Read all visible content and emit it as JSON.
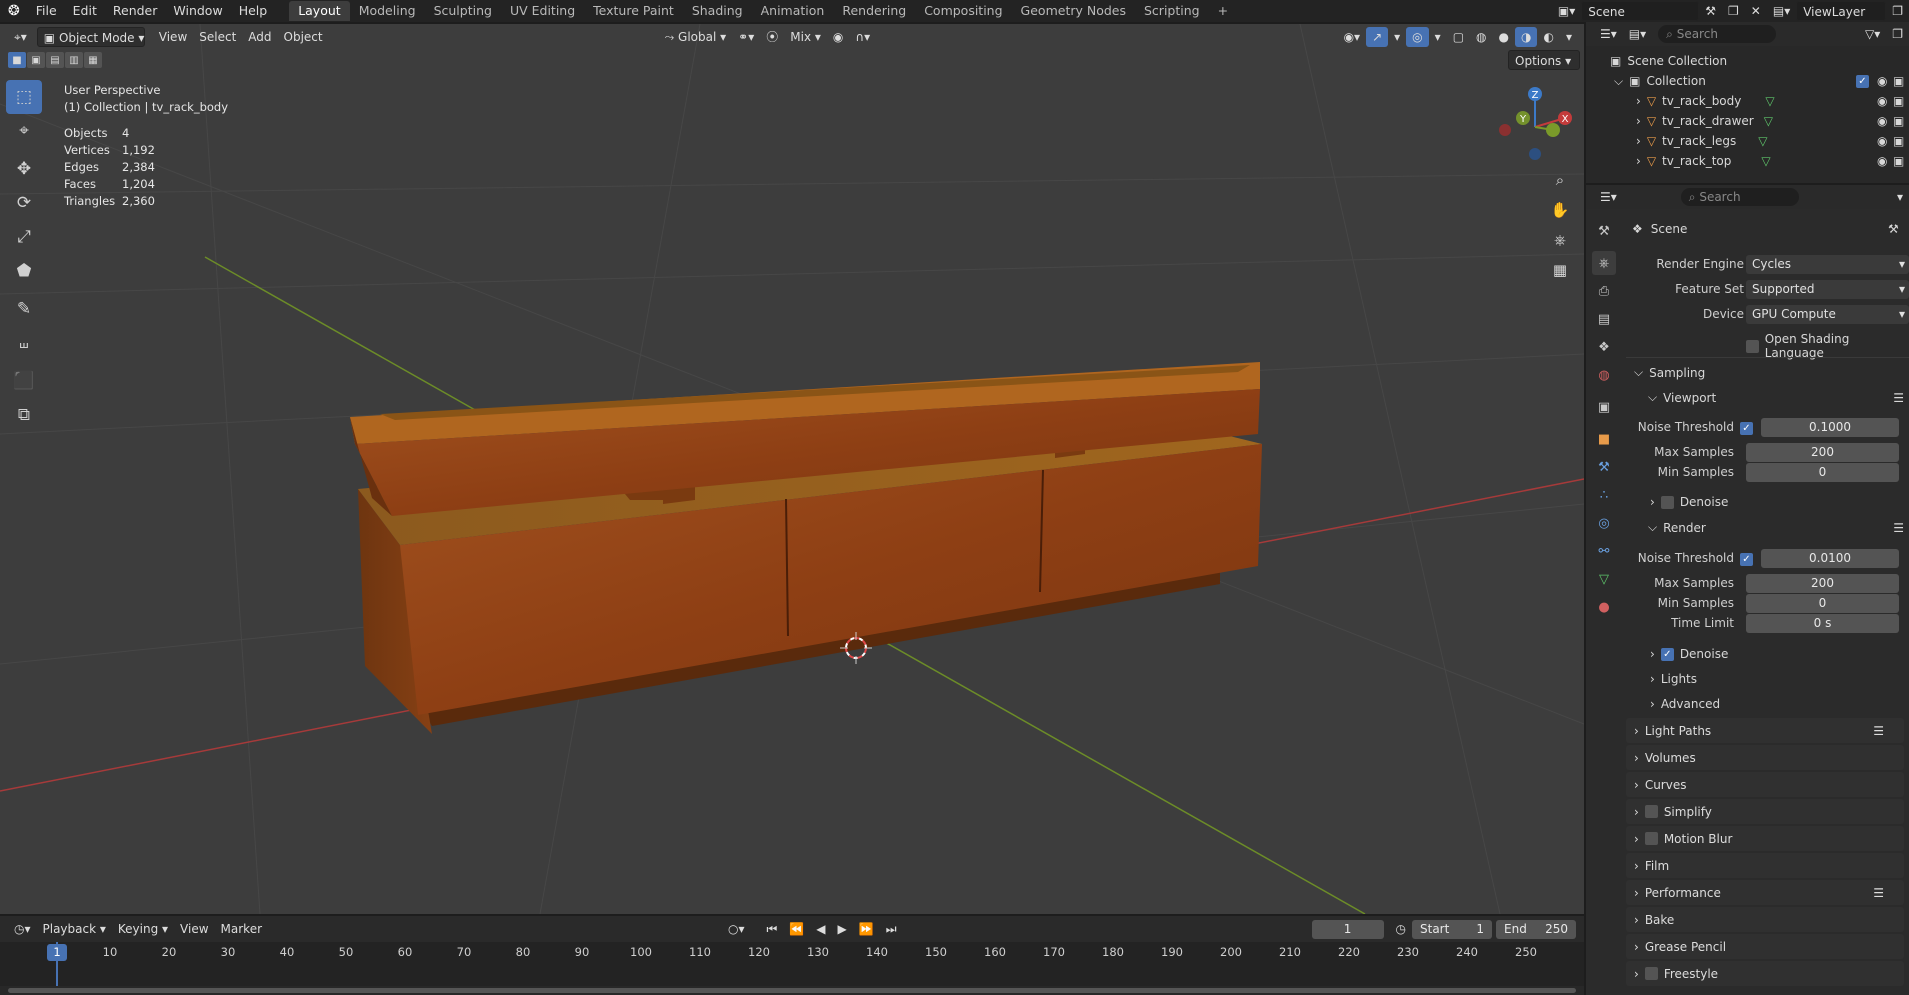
{
  "topbar": {
    "menus": [
      "File",
      "Edit",
      "Render",
      "Window",
      "Help"
    ],
    "workspaces": [
      "Layout",
      "Modeling",
      "Sculpting",
      "UV Editing",
      "Texture Paint",
      "Shading",
      "Animation",
      "Rendering",
      "Compositing",
      "Geometry Nodes",
      "Scripting"
    ],
    "active_workspace": "Layout",
    "scene_name": "Scene",
    "view_layer": "ViewLayer"
  },
  "viewport_header": {
    "mode": "Object Mode",
    "menus": [
      "View",
      "Select",
      "Add",
      "Object"
    ],
    "transform_orientation": "Global",
    "snap_mode": "Mix",
    "options_label": "Options"
  },
  "viewport_info": {
    "perspective": "User Perspective",
    "context": "(1) Collection | tv_rack_body",
    "stats": [
      {
        "label": "Objects",
        "value": "4"
      },
      {
        "label": "Vertices",
        "value": "1,192"
      },
      {
        "label": "Edges",
        "value": "2,384"
      },
      {
        "label": "Faces",
        "value": "1,204"
      },
      {
        "label": "Triangles",
        "value": "2,360"
      }
    ]
  },
  "gizmo": {
    "x": "X",
    "y": "Y",
    "z": "Z"
  },
  "outliner": {
    "search_placeholder": "Search",
    "root": "Scene Collection",
    "collection": "Collection",
    "objects": [
      "tv_rack_body",
      "tv_rack_drawer",
      "tv_rack_legs",
      "tv_rack_top"
    ]
  },
  "properties": {
    "search_placeholder": "Search",
    "context_title": "Scene",
    "render_engine_label": "Render Engine",
    "render_engine": "Cycles",
    "feature_set_label": "Feature Set",
    "feature_set": "Supported",
    "device_label": "Device",
    "device": "GPU Compute",
    "osl_label": "Open Shading Language",
    "sampling": "Sampling",
    "viewport": "Viewport",
    "noise_threshold_label": "Noise Threshold",
    "viewport_noise": "0.1000",
    "max_samples_label": "Max Samples",
    "viewport_max": "200",
    "min_samples_label": "Min Samples",
    "viewport_min": "0",
    "denoise_label": "Denoise",
    "render": "Render",
    "render_noise": "0.0100",
    "render_max": "200",
    "render_min": "0",
    "time_limit_label": "Time Limit",
    "time_limit": "0 s",
    "lights": "Lights",
    "advanced": "Advanced",
    "sections": [
      "Light Paths",
      "Volumes",
      "Curves",
      "Simplify",
      "Motion Blur",
      "Film",
      "Performance",
      "Bake",
      "Grease Pencil",
      "Freestyle"
    ]
  },
  "timeline": {
    "menus": [
      "Playback",
      "Keying",
      "View",
      "Marker"
    ],
    "current_frame": "1",
    "start_label": "Start",
    "start": "1",
    "end_label": "End",
    "end": "250",
    "ruler": [
      "10",
      "20",
      "30",
      "40",
      "50",
      "60",
      "70",
      "80",
      "90",
      "100",
      "110",
      "120",
      "130",
      "140",
      "150",
      "160",
      "170",
      "180",
      "190",
      "200",
      "210",
      "220",
      "230",
      "240",
      "250"
    ],
    "playhead": "1"
  },
  "colors": {
    "accent": "#4772b3",
    "wood": "#9a4a1c",
    "x_axis": "#c43b3b",
    "y_axis": "#7a9a2a"
  }
}
